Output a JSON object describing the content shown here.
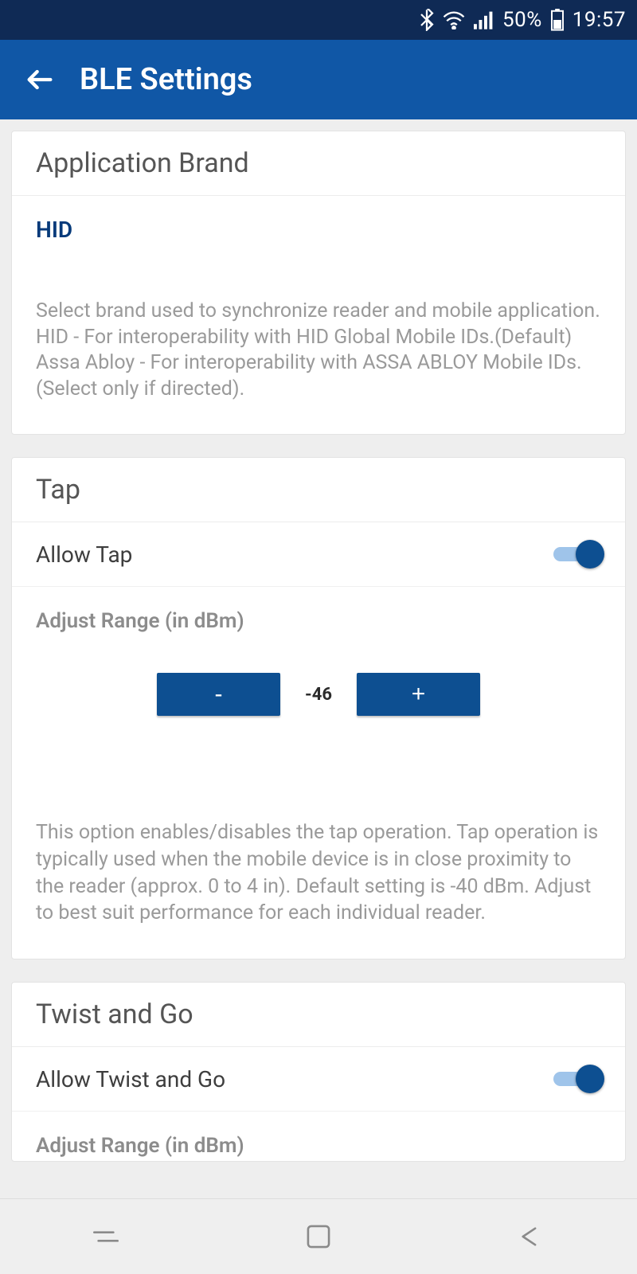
{
  "statusbar": {
    "battery": "50%",
    "time": "19:57"
  },
  "appbar": {
    "title": "BLE Settings"
  },
  "brandCard": {
    "header": "Application Brand",
    "value": "HID",
    "description": "Select brand used to synchronize reader and mobile application.\nHID - For interoperability with HID Global Mobile IDs.(Default)\nAssa Abloy - For interoperability with ASSA ABLOY Mobile IDs. (Select only if directed)."
  },
  "tapCard": {
    "header": "Tap",
    "allowLabel": "Allow Tap",
    "allowOn": true,
    "rangeLabel": "Adjust Range (in dBm)",
    "minusLabel": "-",
    "plusLabel": "+",
    "rangeValue": "-46",
    "description": "This option enables/disables the tap operation. Tap operation is typically used when the mobile device is in close proximity to the reader (approx. 0 to 4 in). Default setting is -40 dBm. Adjust to best suit performance for each individual reader."
  },
  "twistCard": {
    "header": "Twist and Go",
    "allowLabel": "Allow Twist and Go",
    "allowOn": true,
    "rangeLabel": "Adjust Range (in dBm)"
  }
}
